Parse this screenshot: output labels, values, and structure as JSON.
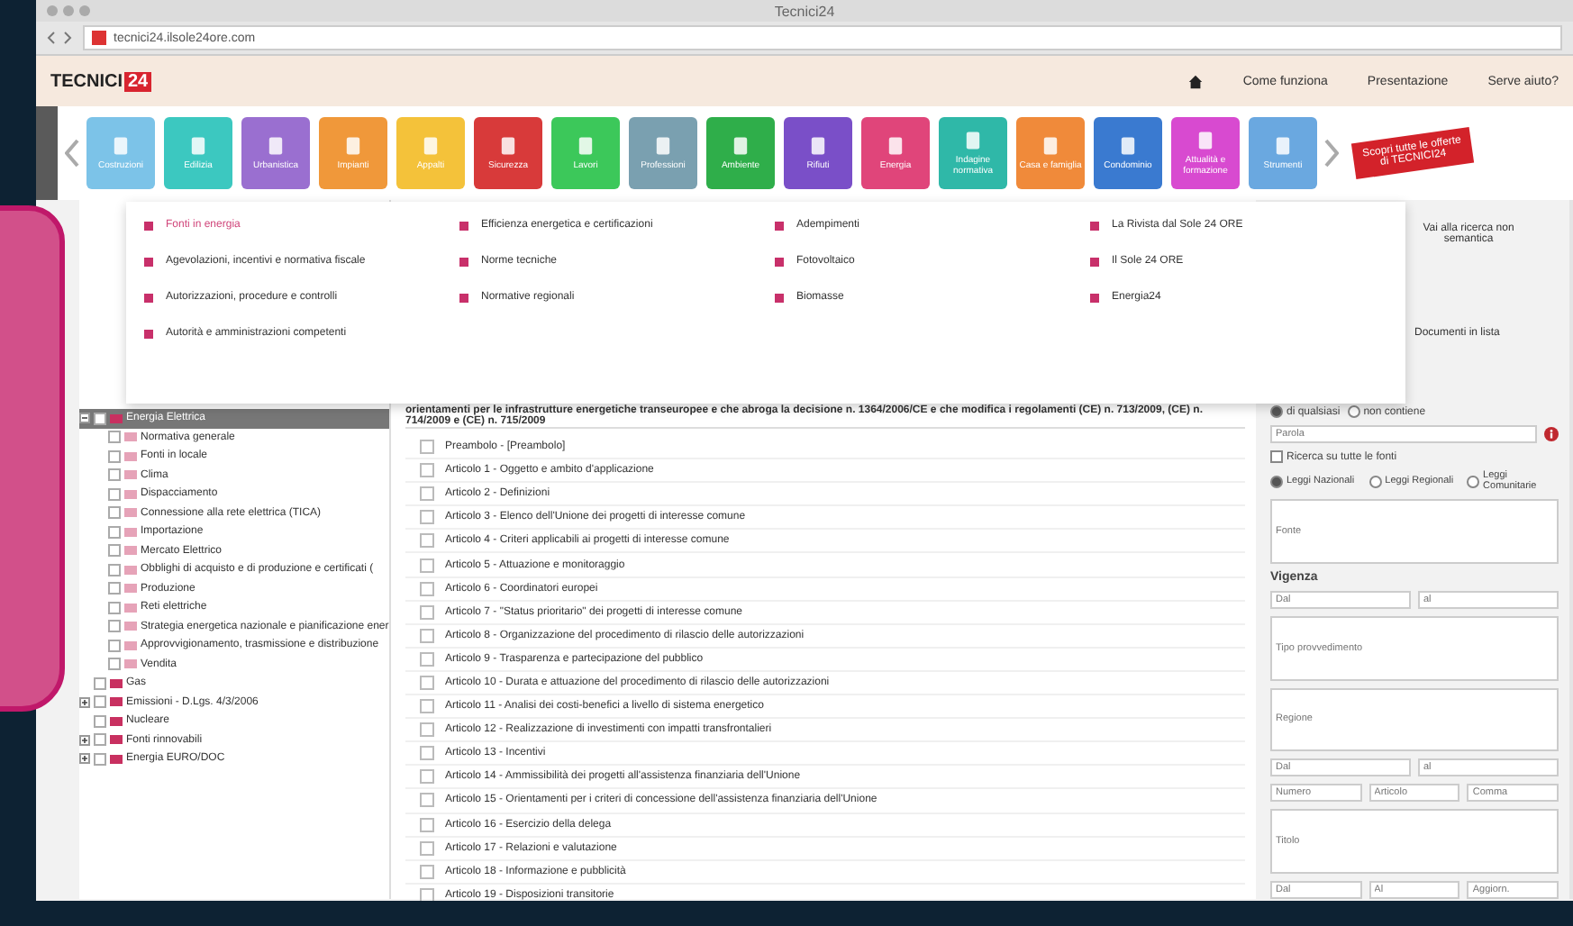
{
  "window": {
    "title": "Tecnici24",
    "url": "tecnici24.ilsole24ore.com"
  },
  "header": {
    "logo": "TECNICI",
    "logo_badge": "24",
    "links": [
      "Come funziona",
      "Presentazione",
      "Serve aiuto?"
    ]
  },
  "tiles": [
    {
      "label": "Costruzioni",
      "color": "#7cc3e8"
    },
    {
      "label": "Edilizia",
      "color": "#3cc8c0"
    },
    {
      "label": "Urbanistica",
      "color": "#9a6fd0"
    },
    {
      "label": "Impianti",
      "color": "#f0983a"
    },
    {
      "label": "Appalti",
      "color": "#f4c23a"
    },
    {
      "label": "Sicurezza",
      "color": "#d83a3a"
    },
    {
      "label": "Lavori",
      "color": "#3cc85a"
    },
    {
      "label": "Professioni",
      "color": "#7aa0b0"
    },
    {
      "label": "Ambiente",
      "color": "#2fae4a"
    },
    {
      "label": "Rifiuti",
      "color": "#7a4fc8"
    },
    {
      "label": "Energia",
      "color": "#e0457a"
    },
    {
      "label": "Indagine normativa",
      "color": "#2fb8a8"
    },
    {
      "label": "Casa e famiglia",
      "color": "#f08a3a"
    },
    {
      "label": "Condominio",
      "color": "#3a7ad0"
    },
    {
      "label": "Attualità e formazione",
      "color": "#d84ad0"
    },
    {
      "label": "Strumenti",
      "color": "#6aa8e0"
    }
  ],
  "promo": "Scopri tutte le offerte di TECNICI24",
  "menu": {
    "columns": [
      [
        {
          "label": "Fonti in energia",
          "selected": true
        },
        {
          "label": "Agevolazioni, incentivi e normativa fiscale",
          "selected": false
        },
        {
          "label": "Autorizzazioni, procedure e controlli",
          "selected": false
        },
        {
          "label": "Autorità e amministrazioni competenti",
          "selected": false
        }
      ],
      [
        {
          "label": "Efficienza energetica e certificazioni",
          "selected": false
        },
        {
          "label": "Norme tecniche",
          "selected": false
        },
        {
          "label": "Normative regionali",
          "selected": false
        }
      ],
      [
        {
          "label": "Adempimenti",
          "selected": false
        },
        {
          "label": "Fotovoltaico",
          "selected": false
        },
        {
          "label": "Biomasse",
          "selected": false
        }
      ],
      [
        {
          "label": "La Rivista dal Sole 24 ORE",
          "selected": false
        },
        {
          "label": "Il Sole 24 ORE",
          "selected": false
        },
        {
          "label": "Energia24",
          "selected": false
        }
      ]
    ]
  },
  "search_link": "Vai alla ricerca non semantica",
  "list_label": "Documenti in lista",
  "tree": [
    {
      "label": "Energia Elettrica",
      "selected": true,
      "expanded": true,
      "children": [
        {
          "label": "Normativa generale",
          "selected": false
        },
        {
          "label": "Fonti in locale",
          "selected": false
        },
        {
          "label": "Clima",
          "selected": false
        },
        {
          "label": "Dispacciamento",
          "selected": false
        },
        {
          "label": "Connessione alla rete elettrica (TICA)",
          "selected": false
        },
        {
          "label": "Importazione",
          "selected": false
        },
        {
          "label": "Mercato Elettrico",
          "selected": false
        },
        {
          "label": "Obblighi di acquisto e di produzione e certificati (",
          "selected": false
        },
        {
          "label": "Produzione",
          "selected": false
        },
        {
          "label": "Reti elettriche",
          "selected": false
        },
        {
          "label": "Strategia energetica nazionale e pianificazione ener",
          "selected": false
        },
        {
          "label": "Approvvigionamento, trasmissione e distribuzione",
          "selected": false
        },
        {
          "label": "Vendita",
          "selected": false
        }
      ]
    },
    {
      "label": "Gas",
      "selected": false
    },
    {
      "label": "Emissioni - D.Lgs. 4/3/2006",
      "selected": false,
      "expanded": false
    },
    {
      "label": "Nucleare",
      "selected": false
    },
    {
      "label": "Fonti rinnovabili",
      "selected": false,
      "expanded": false
    },
    {
      "label": "Energia EURO/DOC",
      "selected": false,
      "expanded": false
    }
  ],
  "document": {
    "title": "orientamenti per le infrastrutture energetiche transeuropee e che abroga la decisione n. 1364/2006/CE e che modifica i regolamenti (CE) n. 713/2009, (CE) n. 714/2009 e (CE) n. 715/2009",
    "articles": [
      "Preambolo - [Preambolo]",
      "Articolo 1 - Oggetto e ambito d'applicazione",
      "Articolo 2 - Definizioni",
      "Articolo 3 - Elenco dell'Unione dei progetti di interesse comune",
      "Articolo 4 - Criteri applicabili ai progetti di interesse comune",
      "Articolo 5 - Attuazione e monitoraggio",
      "Articolo 6 - Coordinatori europei",
      "Articolo 7 - \"Status prioritario\" dei progetti di interesse comune",
      "Articolo 8 - Organizzazione del procedimento di rilascio delle autorizzazioni",
      "Articolo 9 - Trasparenza e partecipazione del pubblico",
      "Articolo 10 - Durata e attuazione del procedimento di rilascio delle autorizzazioni",
      "Articolo 11 - Analisi dei costi-benefici a livello di sistema energetico",
      "Articolo 12 - Realizzazione di investimenti con impatti transfrontalieri",
      "Articolo 13 - Incentivi",
      "Articolo 14 - Ammissibilità dei progetti all'assistenza finanziaria dell'Unione",
      "Articolo 15 - Orientamenti per i criteri di concessione dell'assistenza finanziaria dell'Unione",
      "Articolo 16 - Esercizio della delega",
      "Articolo 17 - Relazioni e valutazione",
      "Articolo 18 - Informazione e pubblicità",
      "Articolo 19 - Disposizioni transitorie"
    ]
  },
  "filters": {
    "match_options": [
      {
        "label": "di qualsiasi",
        "selected": true
      },
      {
        "label": "non contiene",
        "selected": false
      }
    ],
    "word_placeholder": "Parola",
    "all_sources": {
      "label": "Ricerca su tutte le fonti",
      "checked": false
    },
    "law_types": [
      {
        "label": "Leggi Nazionali",
        "selected": true
      },
      {
        "label": "Leggi Regionali",
        "selected": false
      },
      {
        "label": "Leggi Comunitarie",
        "selected": false
      }
    ],
    "source_placeholder": "Fonte",
    "validity_label": "Vigenza",
    "validity_from_placeholder": "Dal",
    "validity_to_placeholder": "al",
    "type_placeholder": "Tipo provvedimento",
    "region_placeholder": "Regione",
    "date_from_placeholder": "Dal",
    "date_to_placeholder": "al",
    "number_placeholder": "Numero",
    "article_placeholder": "Articolo",
    "comma_placeholder": "Comma",
    "title_placeholder": "Titolo",
    "update_from_placeholder": "Dal",
    "update_to_placeholder": "Al",
    "update_placeholder": "Aggiorn."
  }
}
